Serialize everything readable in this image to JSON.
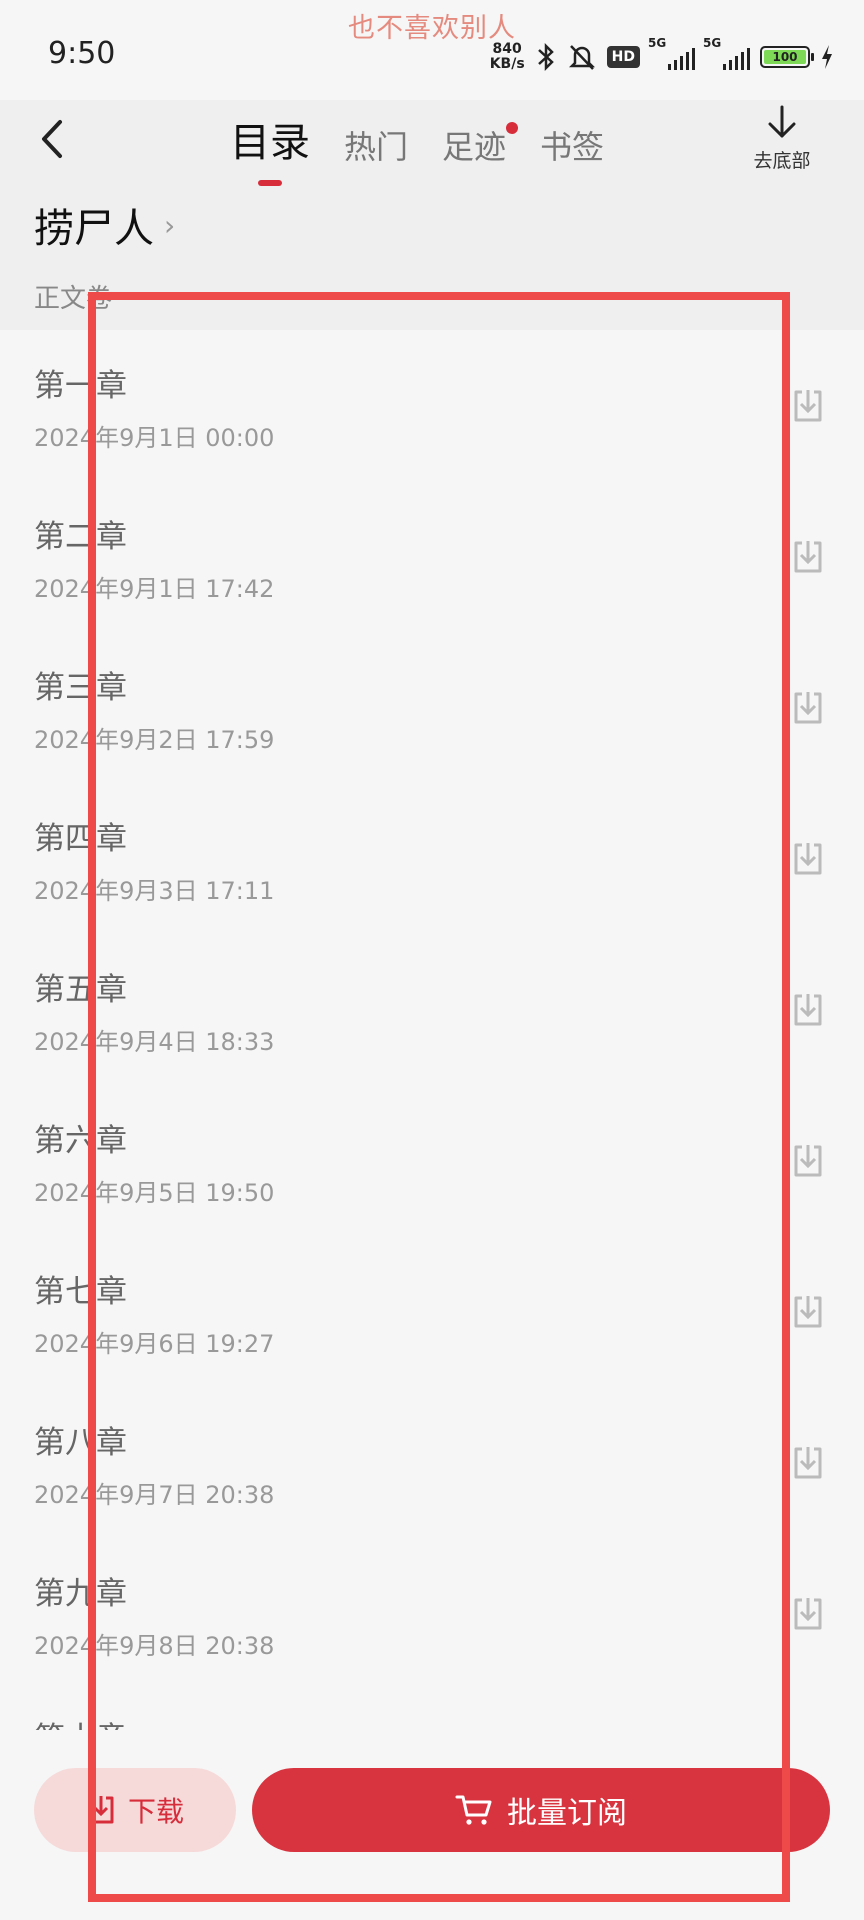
{
  "status_bar": {
    "notification_text": "也不喜欢别人",
    "time": "9:50",
    "net_speed_value": "840",
    "net_speed_unit": "KB/s",
    "hd_label": "HD",
    "signal1_tag": "5G",
    "signal2_tag": "5G",
    "battery_level": "100"
  },
  "header": {
    "tabs": [
      {
        "label": "目录",
        "active": true
      },
      {
        "label": "热门"
      },
      {
        "label": "足迹",
        "badge_dot": true
      },
      {
        "label": "书签"
      }
    ],
    "go_bottom_label": "去底部",
    "book_title": "捞尸人",
    "volume_label": "正文卷"
  },
  "chapters": [
    {
      "name": "第一章",
      "date": "2024年9月1日 00:00"
    },
    {
      "name": "第二章",
      "date": "2024年9月1日 17:42"
    },
    {
      "name": "第三章",
      "date": "2024年9月2日 17:59"
    },
    {
      "name": "第四章",
      "date": "2024年9月3日 17:11"
    },
    {
      "name": "第五章",
      "date": "2024年9月4日 18:33"
    },
    {
      "name": "第六章",
      "date": "2024年9月5日 19:50"
    },
    {
      "name": "第七章",
      "date": "2024年9月6日 19:27"
    },
    {
      "name": "第八章",
      "date": "2024年9月7日 20:38"
    },
    {
      "name": "第九章",
      "date": "2024年9月8日 20:38"
    },
    {
      "name": "第十章",
      "date": ""
    }
  ],
  "bottom_bar": {
    "download_label": "下载",
    "subscribe_label": "批量订阅"
  },
  "colors": {
    "accent": "#d72d3b",
    "selection": "#ee4a4a"
  }
}
